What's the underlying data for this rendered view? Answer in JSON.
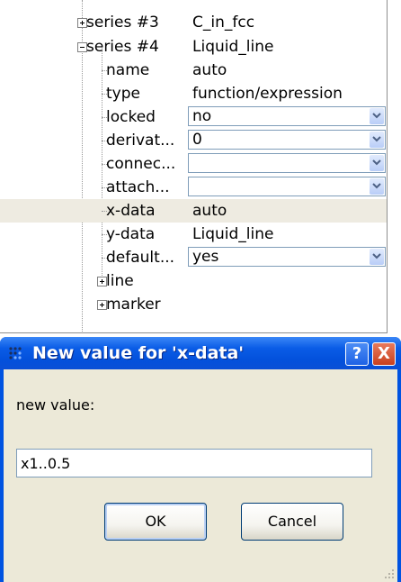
{
  "tree": {
    "rows": [
      {
        "label": "series #3",
        "value": "C_in_fcc",
        "expander": "plus"
      },
      {
        "label": "series #4",
        "value": "Liquid_line",
        "expander": "minus"
      },
      {
        "label": "name",
        "value": "auto"
      },
      {
        "label": "type",
        "value": "function/expression"
      },
      {
        "label": "locked",
        "value": "no",
        "editor": "combo"
      },
      {
        "label": "derivat...",
        "value": "0",
        "editor": "combo"
      },
      {
        "label": "connec...",
        "value": "",
        "editor": "combo"
      },
      {
        "label": "attach...",
        "value": "",
        "editor": "combo"
      },
      {
        "label": "x-data",
        "value": "auto",
        "selected": true
      },
      {
        "label": "y-data",
        "value": "Liquid_line"
      },
      {
        "label": "default...",
        "value": "yes",
        "editor": "combo"
      },
      {
        "label": "line",
        "expander": "plus"
      },
      {
        "label": "marker",
        "expander": "plus"
      }
    ]
  },
  "dialog": {
    "title": "New value for 'x-data'",
    "help_label": "?",
    "close_label": "X",
    "prompt_label": "new value:",
    "input_value": "x1..0.5",
    "ok_label": "OK",
    "cancel_label": "Cancel"
  },
  "colors": {
    "titlebar": "#0a5ce6",
    "dialog_face": "#ece9d8",
    "selected_row": "#eeebe1",
    "close_button": "#c9401e"
  },
  "icons": {
    "app": "app-icon",
    "dropdown": "chevron-down-icon",
    "expand": "plus-box-icon",
    "collapse": "minus-box-icon",
    "resize": "resize-grip-icon"
  }
}
